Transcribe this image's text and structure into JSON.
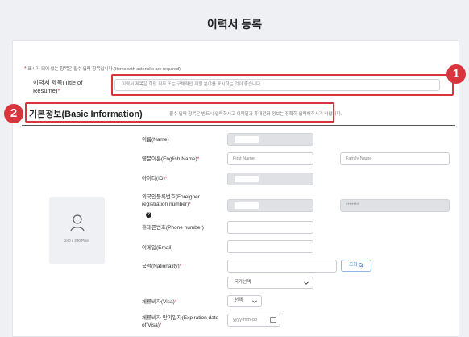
{
  "page": {
    "title": "이력서 등록"
  },
  "notice": {
    "required_text": "표시가 되어 있는 항목은 필수 입력 항목입니다.(Items with asterisks are required)"
  },
  "resume_title": {
    "label": "이력서 제목(Title of Resume)",
    "placeholder": "이력서 제목은 희망 직무 또는 구체적인 지원 분야를 표시하는 것이 좋습니다."
  },
  "annotations": {
    "badge1": "1",
    "badge2": "2"
  },
  "basic_info": {
    "title": "기본정보(Basic Information)",
    "note": "필수 입력 항목은 반드시 입력하시고 이메일과 휴대전화 정보는 정확히 입력해주시기 바랍니다."
  },
  "photo": {
    "size_text": "240 x 290 Pixel",
    "icon": "user-icon"
  },
  "fields": {
    "name": {
      "label": "이름(Name)"
    },
    "english_name": {
      "label": "영문이름(English Name)",
      "first_placeholder": "First Name",
      "family_placeholder": "Family Name"
    },
    "id": {
      "label": "아이디(ID)"
    },
    "foreigner_reg": {
      "label": "외국인등록번호(Foreigner registration number)",
      "masked_value": "*******"
    },
    "phone": {
      "label": "휴대폰번호(Phone number)"
    },
    "email": {
      "label": "이메일(Email)"
    },
    "nationality": {
      "label": "국적(Nationality)",
      "search_label": "조회",
      "select_value": "국가선택"
    },
    "visa": {
      "label": "체류비자(Visa)",
      "select_value": "선택"
    },
    "visa_expiration": {
      "label": "체류비자 만기일자(Expiration date of Visa)",
      "placeholder": "yyyy-mm-dd"
    }
  },
  "colors": {
    "accent_red": "#d9353d",
    "link_blue": "#2b6cc4"
  }
}
